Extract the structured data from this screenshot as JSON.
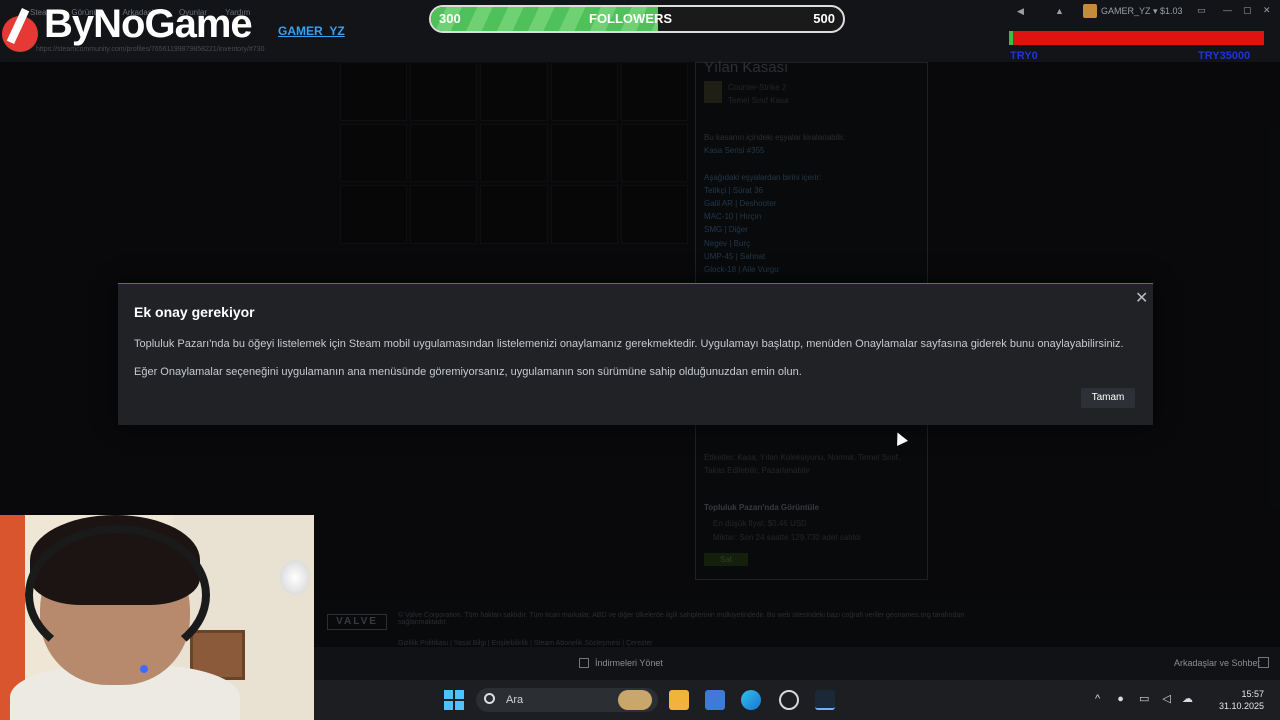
{
  "overlay": {
    "logo": "ByNoGame",
    "username": "GAMER_YZ",
    "followers": {
      "label": "FOLLOWERS",
      "current": "300",
      "goal": "500",
      "progress": 0.55
    },
    "bar_labels": {
      "left": "TRY0",
      "right": "TRY35000"
    }
  },
  "steam": {
    "menu": [
      "Steam",
      "Görünüm",
      "Arkadaşlar",
      "Oyunlar",
      "Yardım"
    ],
    "url": "https://steamcommunity.com/profiles/76561199879858221/inventory/#730",
    "account": "GAMER_YZ ▾ $1.03",
    "item_panel": {
      "title": "Yılan Kasası",
      "type_lines": [
        "Counter-Strike 2",
        "Temel Sınıf Kasa"
      ],
      "desc1": "Bu kasanın içindeki eşyalar kiralanabilir.",
      "series": "Kasa Serisi #355",
      "contains_label": "Aşağıdaki eşyalardan birini içerir:",
      "items": [
        "Tetikçi | Sürat 36",
        "Galil AR | Deshooter",
        "MAC-10 | Hırçın",
        "SMG | Diğer",
        "Negev | Burç",
        "UMP-45 | Sahnat",
        "Glock-18 | Aile Vurgu"
      ],
      "tags": "Etiketler: Kasa, Yılan Koleksiyonu, Normal, Temel Sınıf, Takas Edilebilir, Pazarlanabilir",
      "market_title": "Topluluk Pazarı'nda Görüntüle",
      "market_lowest": "En düşük fiyat: $0.46 USD",
      "market_volume": "Miktar: Son 24 saatte 129.730 adet satıldı",
      "sell_label": "Sat"
    },
    "footer": {
      "valve": "VALVE",
      "copyright": "© Valve Corporation. Tüm hakları saklıdır. Tüm ticari markalar, ABD ve diğer ülkelerde ilgili sahiplerinin mülkiyetindedir. Bu web sitesindeki bazı coğrafi veriler geonames.org tarafından sağlanmaktadır.",
      "links": "Gizlilik Politikası | Yasal Bilgi | Erişilebilirlik | Steam Abonelik Sözleşmesi | Çerezler"
    },
    "downloads_label": "İndirmeleri Yönet",
    "friends_label": "Arkadaşlar ve Sohbet"
  },
  "dialog": {
    "title": "Ek onay gerekiyor",
    "p1": "Topluluk Pazarı'nda bu öğeyi listelemek için Steam mobil uygulamasından listelemenizi onaylamanız gerekmektedir. Uygulamayı başlatıp, menüden Onaylamalar sayfasına giderek bunu onaylayabilirsiniz.",
    "p2": "Eğer Onaylamalar seçeneğini uygulamanın ana menüsünde göremiyorsanız, uygulamanın son sürümüne sahip olduğunuzdan emin olun.",
    "ok_label": "Tamam",
    "close_icon": "close-icon"
  },
  "taskbar": {
    "search_placeholder": "Ara",
    "time": "15:57",
    "date": "31.10.2025"
  }
}
